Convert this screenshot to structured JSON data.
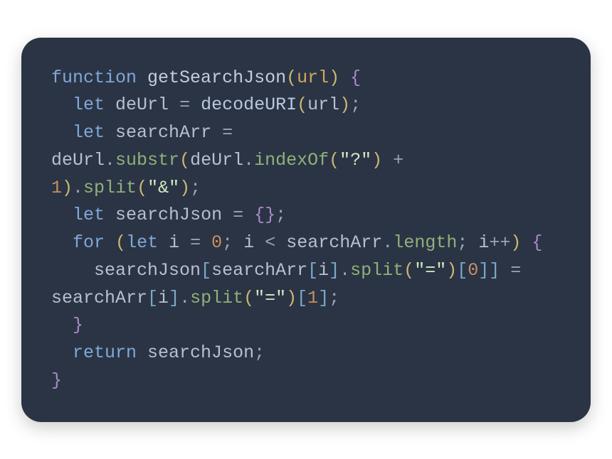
{
  "code": {
    "tokens": {
      "function": "function",
      "getSearchJson": "getSearchJson",
      "url": "url",
      "let1": "let",
      "deUrl": "deUrl",
      "eq1": "=",
      "decodeURI": "decodeURI",
      "let2": "let",
      "searchArr": "searchArr",
      "eq2": "=",
      "substr": "substr",
      "indexOf": "indexOf",
      "qmark": "\"?\"",
      "plus": "+",
      "one": "1",
      "split": "split",
      "amp": "\"&\"",
      "let3": "let",
      "searchJson": "searchJson",
      "eq3": "=",
      "for": "for",
      "let4": "let",
      "i": "i",
      "eq4": "=",
      "zero": "0",
      "lt": "<",
      "length": "length",
      "incr": "++",
      "eqsign": "\"=\"",
      "bracket0": "0",
      "bracket1": "1",
      "return": "return",
      "dot": ".",
      "semi": ";",
      "comma": ",",
      "lparen": "(",
      "rparen": ")",
      "lbrace": "{",
      "rbrace": "}",
      "lbracket": "[",
      "rbracket": "]"
    }
  }
}
